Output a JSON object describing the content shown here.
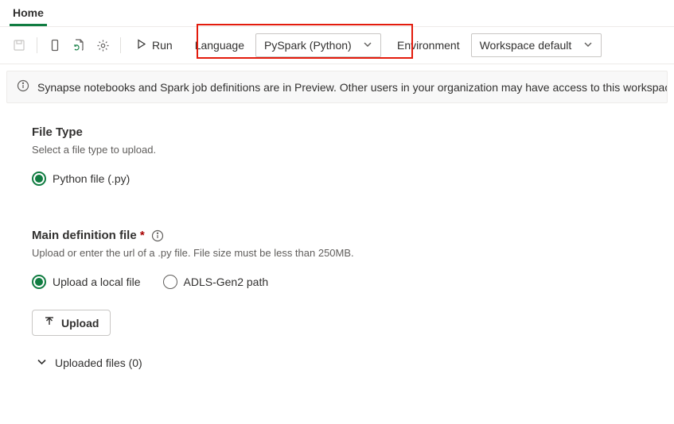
{
  "tabs": {
    "home": "Home"
  },
  "toolbar": {
    "run_label": "Run",
    "language_label": "Language",
    "language_value": "PySpark (Python)",
    "environment_label": "Environment",
    "environment_value": "Workspace default"
  },
  "info_bar": {
    "text": "Synapse notebooks and Spark job definitions are in Preview. Other users in your organization may have access to this workspace. Do not use these items"
  },
  "file_type": {
    "title": "File Type",
    "desc": "Select a file type to upload.",
    "option_python": "Python file (.py)"
  },
  "main_def": {
    "title": "Main definition file",
    "required_mark": "*",
    "desc": "Upload or enter the url of a .py file. File size must be less than 250MB.",
    "option_local": "Upload a local file",
    "option_adls": "ADLS-Gen2 path",
    "upload_btn": "Upload",
    "uploaded_label": "Uploaded files (0)"
  }
}
